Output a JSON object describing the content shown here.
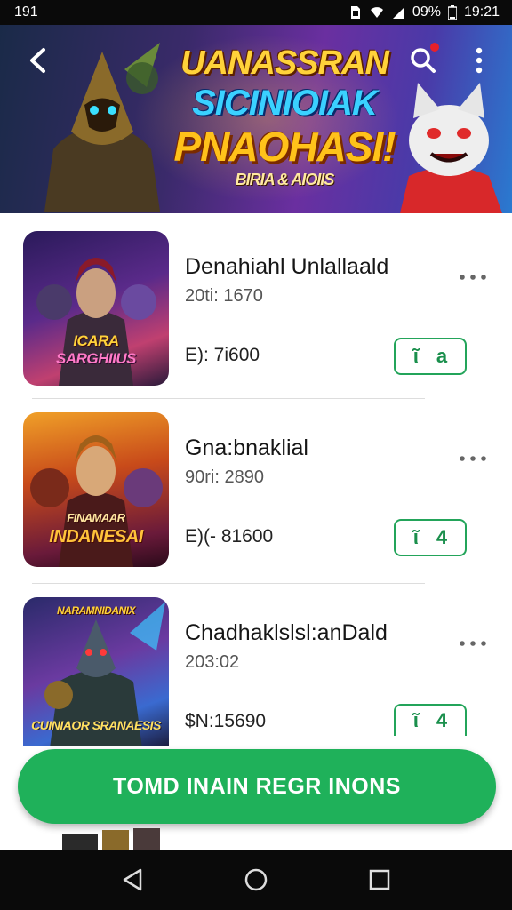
{
  "status_bar": {
    "left_text": "191",
    "battery_text": "09%",
    "time": "19:21",
    "icons": [
      "sim-icon",
      "wifi-icon",
      "signal-icon"
    ]
  },
  "banner": {
    "title_line1": "UANASSRAN",
    "title_line2": "SICINIOIAK",
    "title_line3": "PNAOHASI!",
    "title_line4": "BIRIA & AIOIIS",
    "icons": [
      "back-icon",
      "search-icon",
      "more-vert-icon"
    ],
    "notification_dot_color": "#e8202a"
  },
  "list": {
    "items": [
      {
        "name": "Denahiahl Unlallaald",
        "sub": "20ti: 1670",
        "price": "E): 7i600",
        "thumb_title_top": "ICARA",
        "thumb_title_bottom": "SARGHIIUS",
        "button_left": "ῖ",
        "button_right": "a"
      },
      {
        "name": "Gna:bnaklial",
        "sub": "90ri: 2890",
        "price": "E)(- 81600",
        "thumb_title_top": "FINAMAAR",
        "thumb_title_bottom": "INDANESAI",
        "button_left": "ῖ",
        "button_right": "4"
      },
      {
        "name": "Chadhaklslsl:anDald",
        "sub": "203:02",
        "price": "$N:15690",
        "thumb_title_top": "NARAMNIDANIX",
        "thumb_title_bottom": "CUINIAOR SRANAESIS",
        "button_left": "ῖ",
        "button_right": "4"
      }
    ]
  },
  "cta": {
    "label": "TOMD INAIN REGR INONS"
  },
  "nav": {
    "icons": [
      "back-triangle-icon",
      "home-circle-icon",
      "recents-square-icon"
    ]
  },
  "colors": {
    "accent_green": "#1fb15a",
    "button_outline": "#23a45a",
    "status_bar": "#0a0a0a"
  }
}
